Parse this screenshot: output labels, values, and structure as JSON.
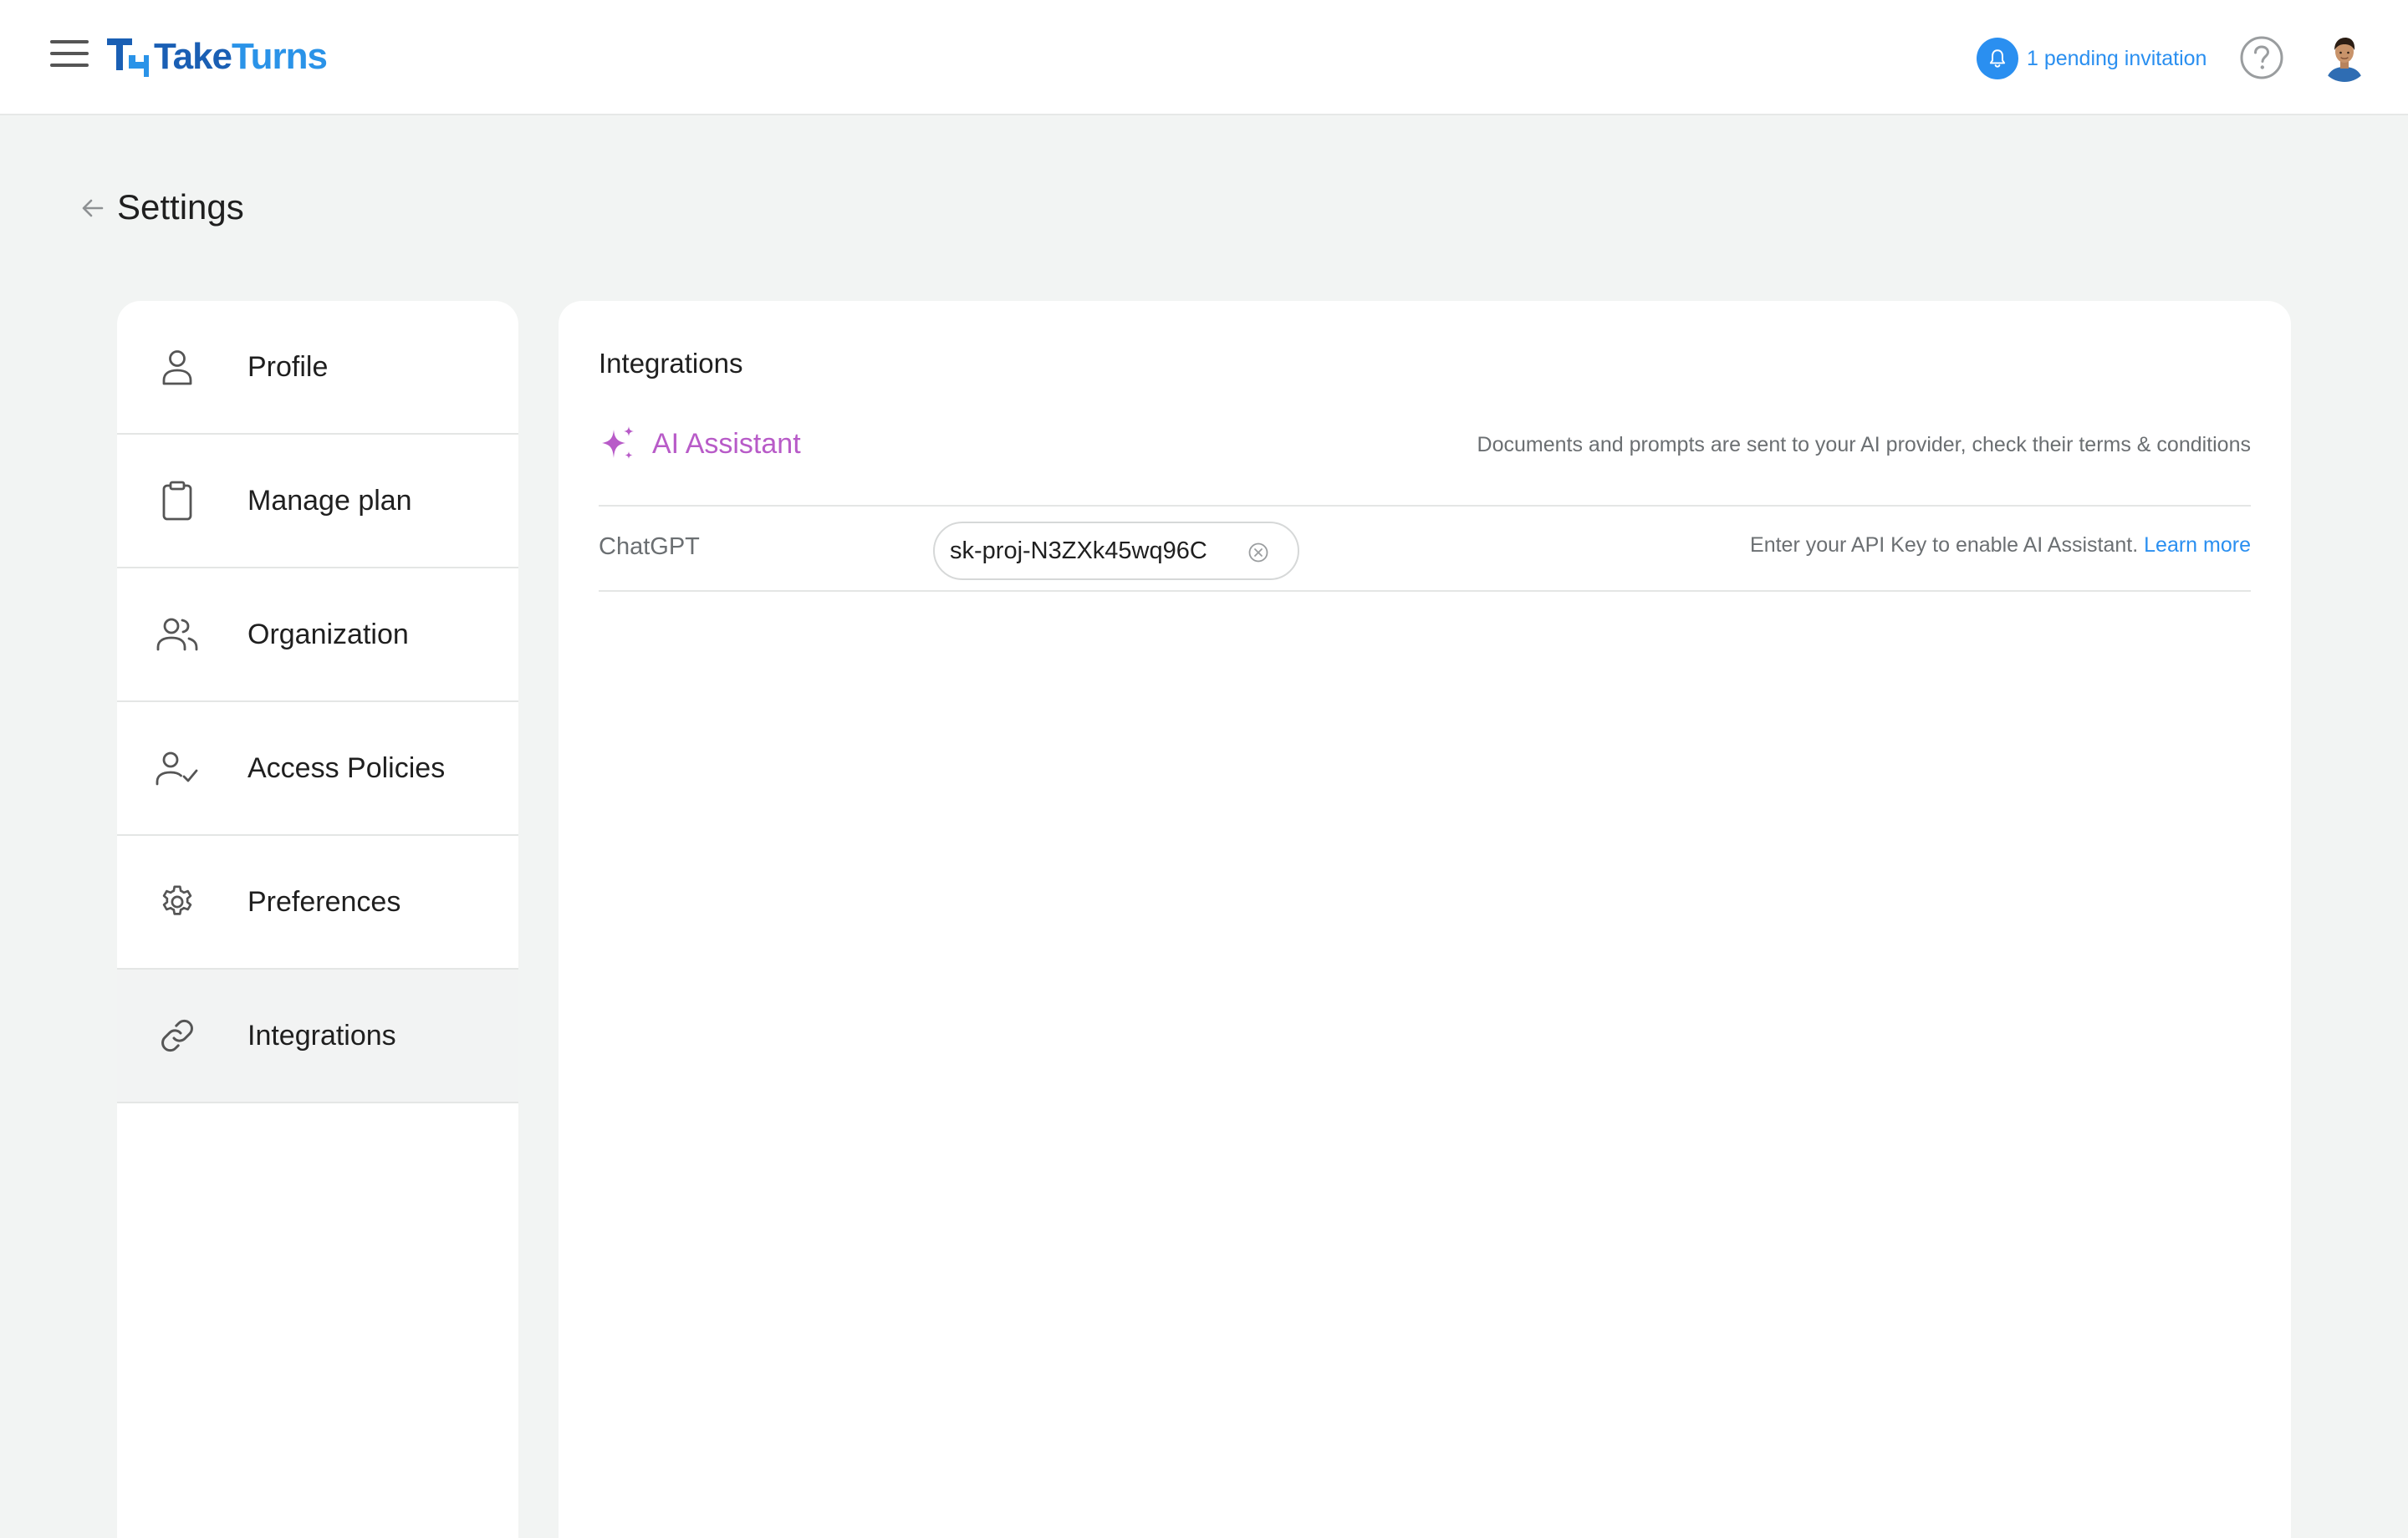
{
  "header": {
    "logo_part1": "Take",
    "logo_part2": "Turns",
    "invitation_text": "1 pending invitation",
    "icons": [
      "menu-icon",
      "bell-icon",
      "help-icon",
      "avatar"
    ]
  },
  "page": {
    "title": "Settings"
  },
  "sidebar": {
    "items": [
      {
        "label": "Profile",
        "icon": "person-icon",
        "active": false
      },
      {
        "label": "Manage plan",
        "icon": "clipboard-icon",
        "active": false
      },
      {
        "label": "Organization",
        "icon": "people-icon",
        "active": false
      },
      {
        "label": "Access Policies",
        "icon": "person-check-icon",
        "active": false
      },
      {
        "label": "Preferences",
        "icon": "gear-icon",
        "active": false
      },
      {
        "label": "Integrations",
        "icon": "link-icon",
        "active": true
      }
    ]
  },
  "main": {
    "title": "Integrations",
    "ai_assistant": {
      "title": "AI Assistant",
      "note": "Documents and prompts are sent to your AI provider, check their terms & conditions"
    },
    "chatgpt": {
      "label": "ChatGPT",
      "api_key_value": "sk-proj-N3ZXk45wq96C",
      "note": "Enter your API Key to enable AI Assistant.",
      "learn_more": "Learn more"
    }
  },
  "colors": {
    "accent_blue": "#2a8ff0",
    "logo_dark_blue": "#1a5fb4",
    "ai_purple": "#b85bc8",
    "background": "#f2f4f3"
  }
}
